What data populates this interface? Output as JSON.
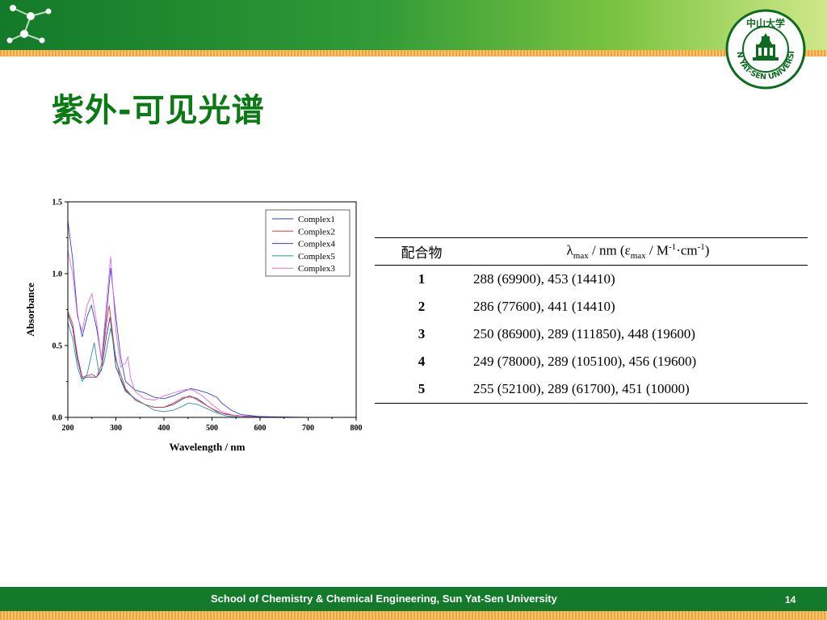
{
  "slide": {
    "title": "紫外-可见光谱",
    "footer_text": "School of Chemistry & Chemical Engineering, Sun Yat-Sen University",
    "page_number": "14",
    "logo_text": "中山大学 SUN YAT-SEN UNIVERSITY"
  },
  "chart_data": {
    "type": "line",
    "title": "",
    "xlabel": "Wavelength / nm",
    "ylabel": "Absorbance",
    "xlim": [
      200,
      800
    ],
    "ylim": [
      0,
      1.5
    ],
    "xticks": [
      200,
      300,
      400,
      500,
      600,
      700,
      800
    ],
    "yticks": [
      0.0,
      0.5,
      1.0,
      1.5
    ],
    "ytick_labels": [
      "0.0",
      "0.5",
      "1.0",
      "1.5"
    ],
    "grid": false,
    "legend_position": "top-right",
    "series": [
      {
        "name": "Complex1",
        "color": "#2a3f9c",
        "x": [
          200,
          210,
          220,
          230,
          240,
          250,
          260,
          270,
          280,
          288,
          300,
          320,
          340,
          360,
          380,
          400,
          420,
          440,
          453,
          470,
          490,
          510,
          530,
          560,
          600,
          650,
          700,
          800
        ],
        "y": [
          0.72,
          0.62,
          0.4,
          0.27,
          0.28,
          0.28,
          0.28,
          0.33,
          0.56,
          0.7,
          0.35,
          0.19,
          0.13,
          0.09,
          0.07,
          0.07,
          0.09,
          0.13,
          0.15,
          0.13,
          0.08,
          0.04,
          0.02,
          0.01,
          0.005,
          0.0,
          0.0,
          0.0
        ]
      },
      {
        "name": "Complex2",
        "color": "#e03a3a",
        "x": [
          200,
          210,
          220,
          230,
          240,
          250,
          260,
          270,
          280,
          286,
          300,
          320,
          340,
          360,
          380,
          400,
          420,
          441,
          460,
          480,
          500,
          520,
          550,
          600,
          700,
          800
        ],
        "y": [
          0.74,
          0.65,
          0.43,
          0.28,
          0.29,
          0.3,
          0.28,
          0.37,
          0.64,
          0.78,
          0.4,
          0.2,
          0.12,
          0.09,
          0.07,
          0.07,
          0.1,
          0.14,
          0.14,
          0.1,
          0.06,
          0.03,
          0.01,
          0.0,
          0.0,
          0.0
        ]
      },
      {
        "name": "Complex4",
        "color": "#3347c8",
        "x": [
          200,
          210,
          220,
          230,
          240,
          249,
          260,
          270,
          280,
          289,
          300,
          310,
          320,
          340,
          360,
          380,
          400,
          420,
          440,
          456,
          470,
          490,
          510,
          520,
          540,
          560,
          600,
          700,
          800
        ],
        "y": [
          1.37,
          1.1,
          0.72,
          0.56,
          0.7,
          0.78,
          0.62,
          0.4,
          0.7,
          1.04,
          0.7,
          0.42,
          0.25,
          0.19,
          0.17,
          0.14,
          0.13,
          0.15,
          0.18,
          0.2,
          0.19,
          0.17,
          0.14,
          0.1,
          0.05,
          0.02,
          0.005,
          0.0,
          0.0
        ]
      },
      {
        "name": "Complex5",
        "color": "#2f8fa8",
        "x": [
          200,
          210,
          220,
          230,
          240,
          255,
          265,
          275,
          289,
          300,
          310,
          320,
          340,
          360,
          380,
          400,
          420,
          440,
          451,
          470,
          490,
          510,
          530,
          560,
          600,
          700,
          800
        ],
        "y": [
          0.66,
          0.55,
          0.35,
          0.25,
          0.3,
          0.52,
          0.3,
          0.38,
          0.62,
          0.42,
          0.26,
          0.18,
          0.13,
          0.09,
          0.05,
          0.04,
          0.05,
          0.08,
          0.1,
          0.09,
          0.06,
          0.03,
          0.01,
          0.0,
          0.0,
          0.0,
          0.0
        ]
      },
      {
        "name": "Complex3",
        "color": "#e26ee0",
        "x": [
          200,
          210,
          220,
          230,
          240,
          250,
          260,
          270,
          280,
          289,
          300,
          310,
          320,
          325,
          330,
          340,
          360,
          380,
          400,
          420,
          440,
          448,
          460,
          480,
          500,
          520,
          550,
          600,
          700,
          800
        ],
        "y": [
          1.16,
          1.0,
          0.7,
          0.6,
          0.78,
          0.86,
          0.66,
          0.4,
          0.78,
          1.12,
          0.6,
          0.35,
          0.38,
          0.42,
          0.28,
          0.18,
          0.13,
          0.12,
          0.15,
          0.17,
          0.19,
          0.195,
          0.19,
          0.15,
          0.09,
          0.04,
          0.01,
          0.0,
          0.0,
          0.0
        ]
      }
    ]
  },
  "table": {
    "header_col1": "配合物",
    "header_lambda": "λ",
    "header_max1": "max",
    "header_unit1": " / nm (",
    "header_eps": "ε",
    "header_max2": "max",
    "header_unit2": " / M",
    "header_sup1": "-1",
    "header_unit3": "·cm",
    "header_sup2": "-1",
    "header_close": ")",
    "rows": [
      {
        "id": "1",
        "values": "288 (69900), 453 (14410)"
      },
      {
        "id": "2",
        "values": "286 (77600), 441 (14410)"
      },
      {
        "id": "3",
        "values": "250 (86900), 289 (111850), 448 (19600)"
      },
      {
        "id": "4",
        "values": "249 (78000), 289 (105100), 456 (19600)"
      },
      {
        "id": "5",
        "values": "255 (52100), 289 (61700), 451 (10000)"
      }
    ]
  }
}
